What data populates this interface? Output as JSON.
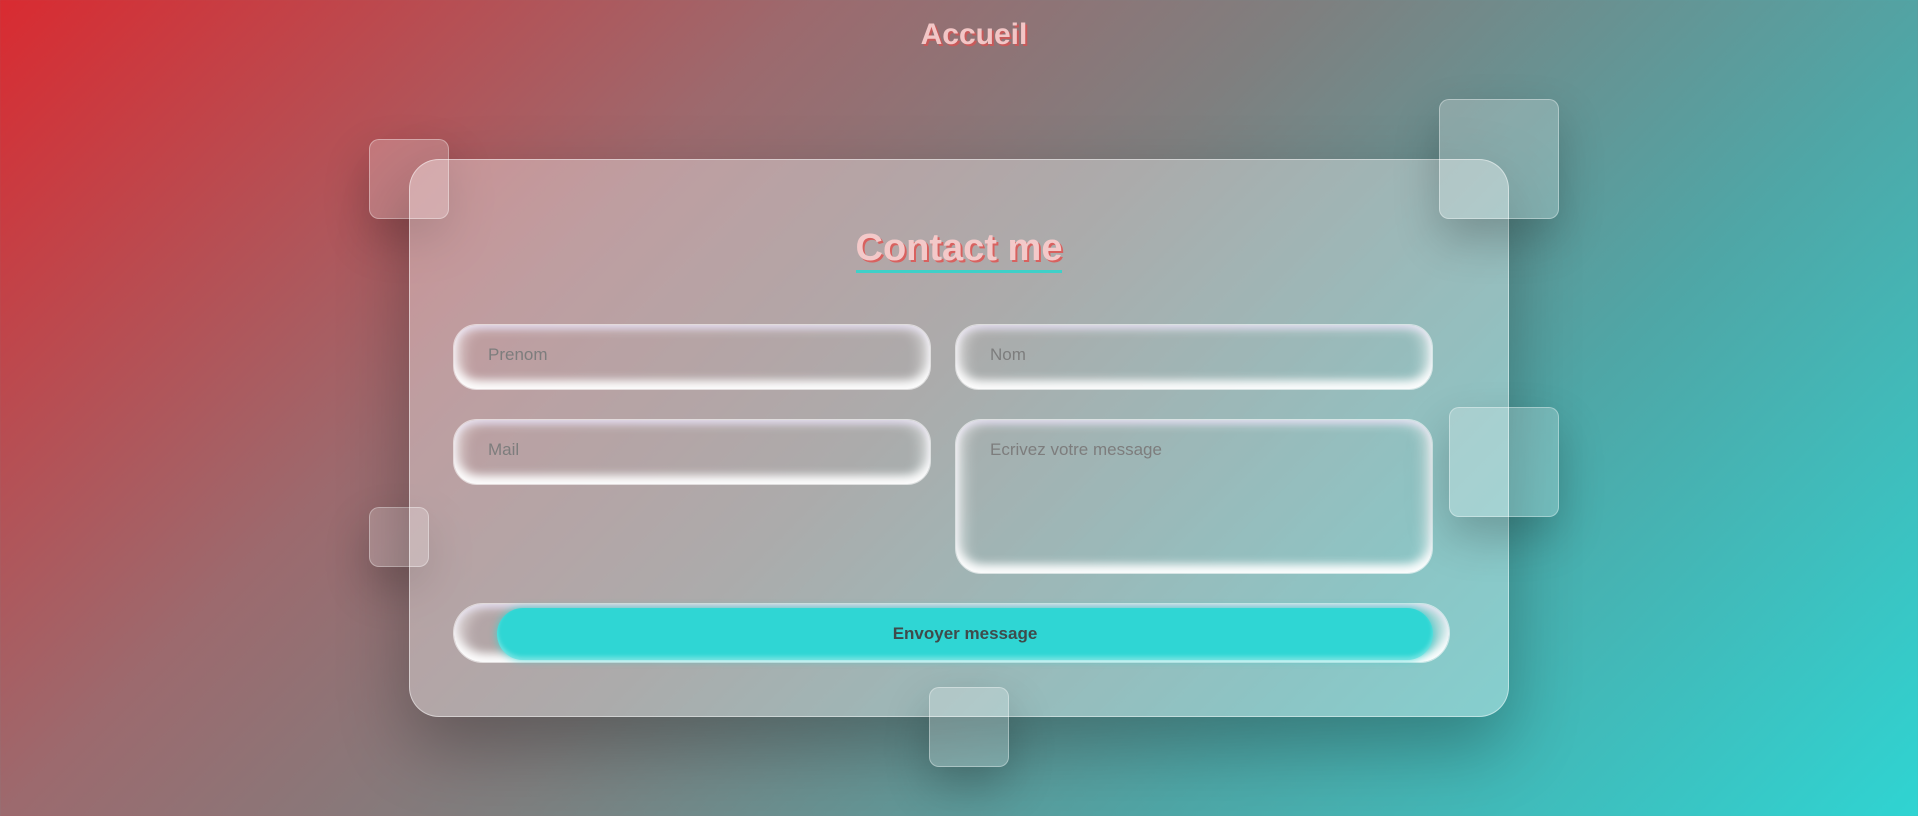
{
  "nav": {
    "home_label": "Accueil"
  },
  "contact": {
    "title": "Contact me",
    "fields": {
      "prenom_placeholder": "Prenom",
      "nom_placeholder": "Nom",
      "mail_placeholder": "Mail",
      "message_placeholder": "Ecrivez votre message"
    },
    "submit_label": "Envoyer message"
  },
  "colors": {
    "gradient_start": "#d92b31",
    "gradient_end": "#2fd4d2",
    "button": "#2fd6d4",
    "title_text": "#f3c9c9"
  }
}
